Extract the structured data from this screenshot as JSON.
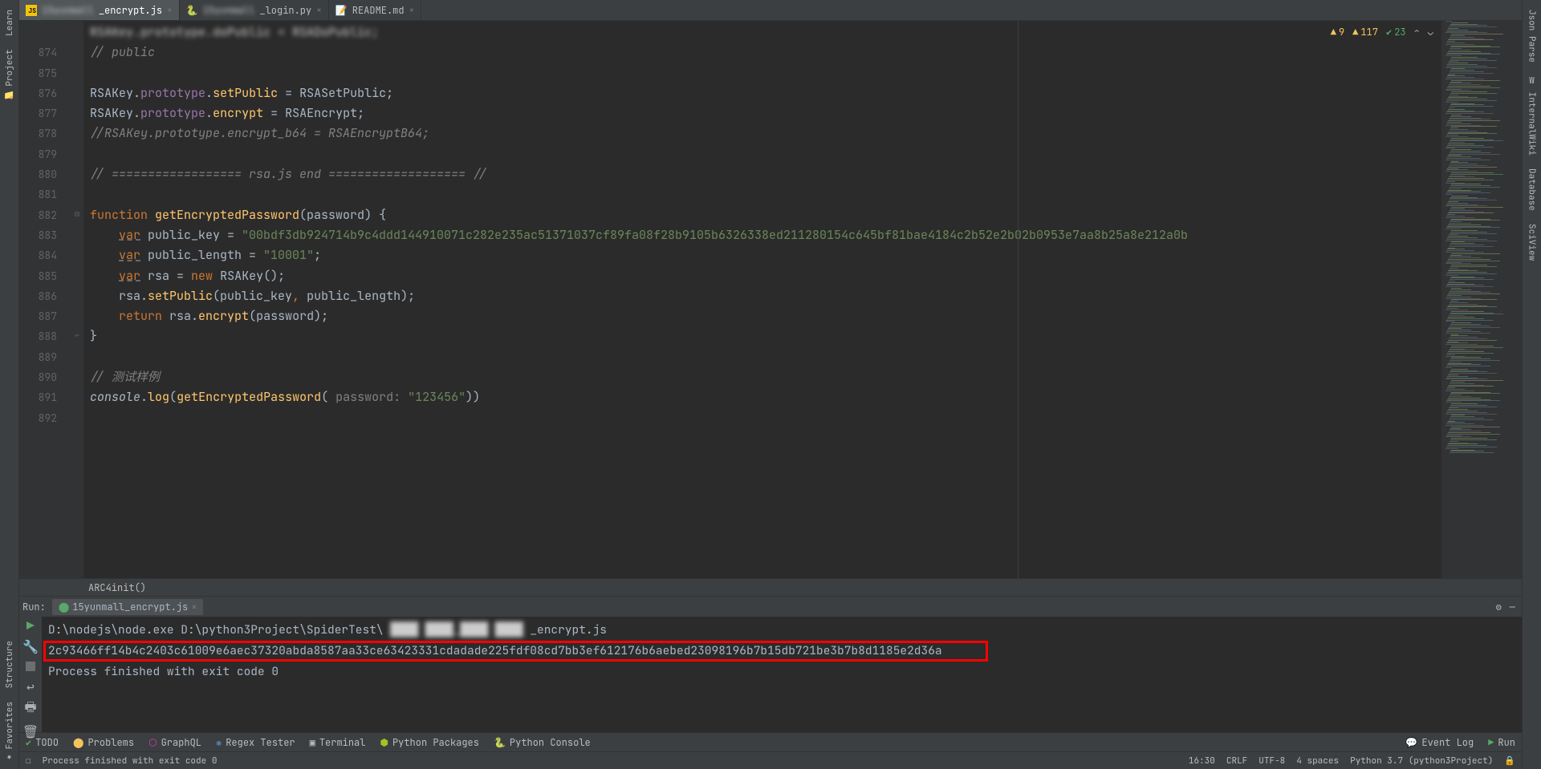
{
  "left_rail": {
    "learn": "Learn",
    "project": "Project",
    "structure": "Structure",
    "favorites": "Favorites"
  },
  "right_rail": {
    "json_parse": "Json Parse",
    "wiki": "InternalWiki",
    "database": "Database",
    "sciview": "SciView"
  },
  "tabs": [
    {
      "label": "_encrypt.js",
      "blur": "15yunmall",
      "active": true,
      "type": "js"
    },
    {
      "label": "_login.py",
      "blur": "15yunmall",
      "active": false,
      "type": "py"
    },
    {
      "label": "README.md",
      "blur": "",
      "active": false,
      "type": "md"
    }
  ],
  "inspections": {
    "warn": "9",
    "err": "117",
    "ok": "23"
  },
  "gutter_start": 874,
  "code": [
    {
      "n": 874,
      "seg": [
        [
          "comment",
          "// public"
        ]
      ]
    },
    {
      "n": 875,
      "seg": []
    },
    {
      "n": 876,
      "seg": [
        [
          "ident",
          "RSAKey"
        ],
        [
          "ident",
          "."
        ],
        [
          "prop",
          "prototype"
        ],
        [
          "ident",
          "."
        ],
        [
          "func",
          "setPublic"
        ],
        [
          "ident",
          " = "
        ],
        [
          "ident",
          "RSASetPublic"
        ],
        [
          "ident",
          ";"
        ]
      ]
    },
    {
      "n": 877,
      "seg": [
        [
          "ident",
          "RSAKey"
        ],
        [
          "ident",
          "."
        ],
        [
          "prop",
          "prototype"
        ],
        [
          "ident",
          "."
        ],
        [
          "func",
          "encrypt"
        ],
        [
          "ident",
          " = "
        ],
        [
          "ident",
          "RSAEncrypt"
        ],
        [
          "ident",
          ";"
        ]
      ]
    },
    {
      "n": 878,
      "seg": [
        [
          "comment",
          "//RSAKey.prototype.encrypt_b64 = RSAEncryptB64;"
        ]
      ]
    },
    {
      "n": 879,
      "seg": []
    },
    {
      "n": 880,
      "seg": [
        [
          "comment",
          "// ================== rsa.js end =================== //"
        ]
      ]
    },
    {
      "n": 881,
      "seg": []
    },
    {
      "n": 882,
      "fold": "start",
      "seg": [
        [
          "kw",
          "function "
        ],
        [
          "func",
          "getEncryptedPassword"
        ],
        [
          "ident",
          "("
        ],
        [
          "ident",
          "password"
        ],
        [
          "ident",
          ") {"
        ]
      ]
    },
    {
      "n": 883,
      "indent": 1,
      "seg": [
        [
          "kwu",
          "var"
        ],
        [
          "ident",
          " public_key = "
        ],
        [
          "str",
          "\"00bdf3db924714b9c4ddd144910071c282e235ac51371037cf89fa08f28b9105b6326338ed211280154c645bf81bae4184c2b52e2b02b0953e7aa8b25a8e212a0b"
        ]
      ]
    },
    {
      "n": 884,
      "indent": 1,
      "seg": [
        [
          "kwu",
          "var"
        ],
        [
          "ident",
          " public_length = "
        ],
        [
          "str",
          "\"10001\""
        ],
        [
          "ident",
          ";"
        ]
      ]
    },
    {
      "n": 885,
      "indent": 1,
      "seg": [
        [
          "kwu",
          "var"
        ],
        [
          "ident",
          " rsa = "
        ],
        [
          "new",
          "new "
        ],
        [
          "ident",
          "RSAKey();"
        ]
      ]
    },
    {
      "n": 886,
      "indent": 1,
      "seg": [
        [
          "ident",
          "rsa."
        ],
        [
          "func",
          "setPublic"
        ],
        [
          "ident",
          "(public_key"
        ],
        [
          "kw",
          ", "
        ],
        [
          "ident",
          "public_length);"
        ]
      ]
    },
    {
      "n": 887,
      "indent": 1,
      "seg": [
        [
          "kw",
          "return "
        ],
        [
          "ident",
          "rsa."
        ],
        [
          "func",
          "encrypt"
        ],
        [
          "ident",
          "(password);"
        ]
      ]
    },
    {
      "n": 888,
      "fold": "end",
      "seg": [
        [
          "ident",
          "}"
        ]
      ]
    },
    {
      "n": 889,
      "seg": []
    },
    {
      "n": 890,
      "seg": [
        [
          "comment",
          "// 测试样例"
        ]
      ]
    },
    {
      "n": 891,
      "seg": [
        [
          "console",
          "console"
        ],
        [
          "ident",
          "."
        ],
        [
          "func",
          "log"
        ],
        [
          "ident",
          "("
        ],
        [
          "func",
          "getEncryptedPassword"
        ],
        [
          "ident",
          "( "
        ],
        [
          "param",
          "password: "
        ],
        [
          "str",
          "\"123456\""
        ],
        [
          "ident",
          "))"
        ]
      ]
    },
    {
      "n": 892,
      "seg": []
    }
  ],
  "code_prefix_line": {
    "segs": [
      [
        "ident",
        "RSAKey."
      ],
      [
        "prop",
        "prototype"
      ],
      [
        "ident",
        "."
      ],
      [
        "func",
        "doPublic"
      ],
      [
        "ident",
        " = RSADoPublic;"
      ]
    ],
    "blurred": true
  },
  "breadcrumb": "ARC4init()",
  "run": {
    "label": "Run:",
    "tab": "15yunmall_encrypt.js",
    "lines": [
      {
        "pre": "D:\\nodejs\\node.exe D:\\python3Project\\SpiderTest\\",
        "blur": " ████ ████_████ ████ ",
        "post": "_encrypt.js"
      },
      {
        "text": "2c93466ff14b4c2403c61009e6aec37320abda8587aa33ce63423331cdadade225fdf08cd7bb3ef612176b6aebed23098196b7b15db721be3b7b8d1185e2d36a",
        "highlight": true
      },
      {
        "text": ""
      },
      {
        "text": "Process finished with exit code 0"
      }
    ]
  },
  "bottom": {
    "todo": "TODO",
    "problems": "Problems",
    "graphql": "GraphQL",
    "regex": "Regex Tester",
    "terminal": "Terminal",
    "pypkg": "Python Packages",
    "pycon": "Python Console",
    "eventlog": "Event Log",
    "run": "Run"
  },
  "status": {
    "msg": "Process finished with exit code 0",
    "pos": "16:30",
    "crlf": "CRLF",
    "enc": "UTF-8",
    "indent": "4 spaces",
    "py": "Python 3.7 (python3Project)"
  }
}
